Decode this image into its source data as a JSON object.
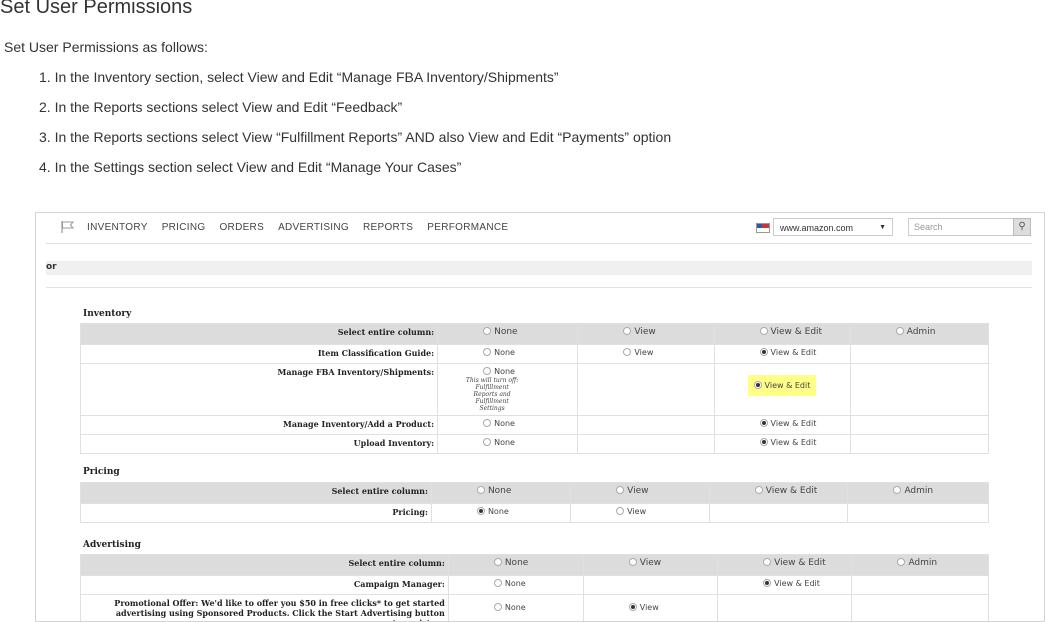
{
  "doc": {
    "title": "Set User Permissions",
    "intro": "Set User Permissions as follows:",
    "steps": [
      "1. In the Inventory section, select View and Edit “Manage FBA Inventory/Shipments”",
      "2. In the Reports sections select View and Edit “Feedback”",
      "3. In the Reports sections select View “Fulfillment Reports” AND also View and Edit “Payments” option",
      "4. In the Settings section select View and Edit “Manage Your Cases”"
    ]
  },
  "nav": {
    "items": [
      "INVENTORY",
      "PRICING",
      "ORDERS",
      "ADVERTISING",
      "REPORTS",
      "PERFORMANCE"
    ],
    "site": "www.amazon.com",
    "search_placeholder": "Search"
  },
  "subbar_label": "or",
  "columns": {
    "select_all": "Select entire column:",
    "none": "None",
    "view": "View",
    "view_edit": "View & Edit",
    "admin": "Admin"
  },
  "sections": {
    "inventory": {
      "title": "Inventory",
      "rows": [
        {
          "label": "Item Classification Guide:",
          "selected": "View & Edit"
        },
        {
          "label": "Manage FBA Inventory/Shipments:",
          "selected": "View & Edit",
          "note": "This will turn off: Fulfillment Reports and Fulfillment Settings"
        },
        {
          "label": "Manage Inventory/Add a Product:",
          "selected": "View & Edit"
        },
        {
          "label": "Upload Inventory:",
          "selected": "View & Edit"
        }
      ]
    },
    "pricing": {
      "title": "Pricing",
      "rows": [
        {
          "label": "Pricing:",
          "selected": "None"
        }
      ]
    },
    "advertising": {
      "title": "Advertising",
      "rows": [
        {
          "label": "Campaign Manager:",
          "selected": "View & Edit"
        },
        {
          "label": "Promotional Offer: We'd like to offer you $50 in free clicks* to get started advertising using Sponsored Products. Click the Start Advertising button to register.:",
          "selected": "View"
        }
      ]
    }
  }
}
